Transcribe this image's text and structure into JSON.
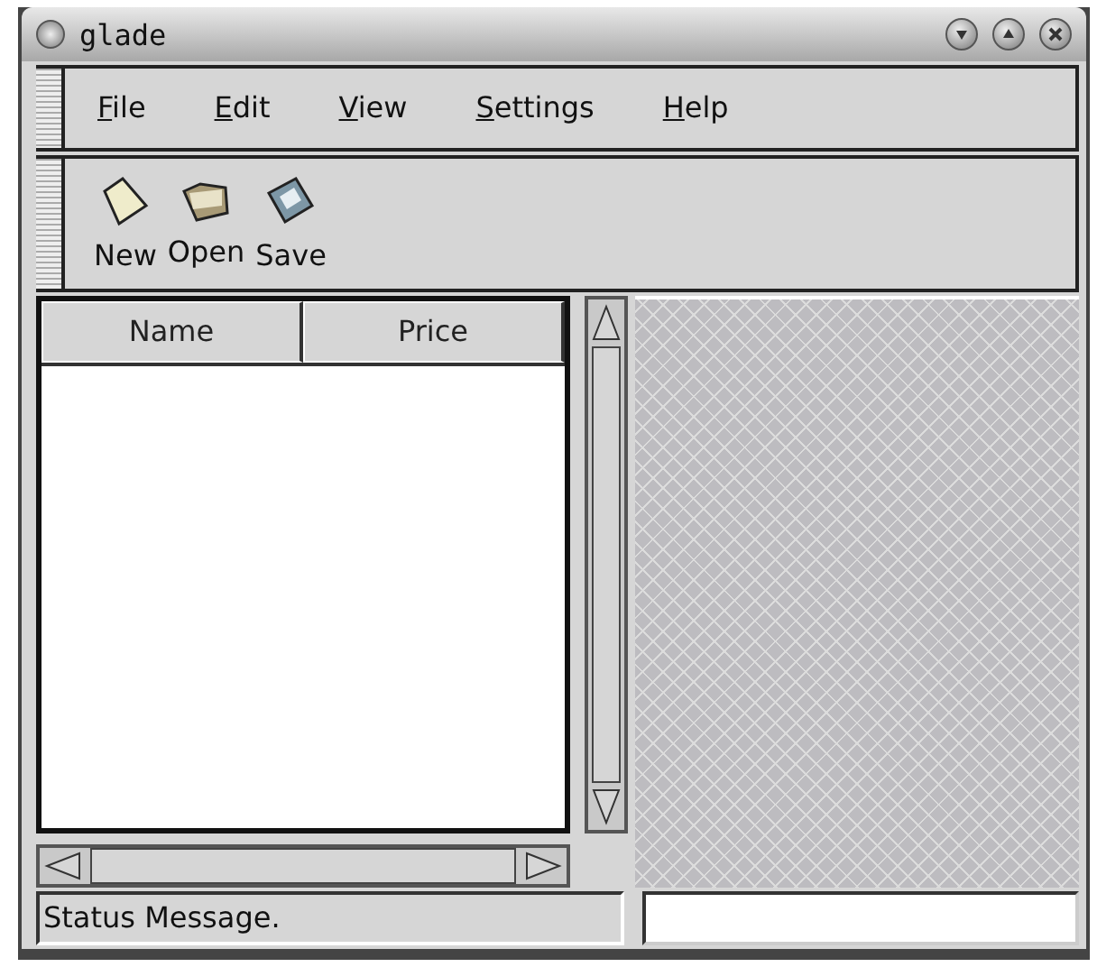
{
  "window": {
    "title": "glade"
  },
  "menu": [
    {
      "label": "File"
    },
    {
      "label": "Edit"
    },
    {
      "label": "View"
    },
    {
      "label": "Settings"
    },
    {
      "label": "Help"
    }
  ],
  "toolbar": [
    {
      "label": "New",
      "kind": "new"
    },
    {
      "label": "Open",
      "kind": "open"
    },
    {
      "label": "Save",
      "kind": "save"
    }
  ],
  "table": {
    "columns": [
      "Name",
      "Price"
    ]
  },
  "status_bar": {
    "message": "Status Message."
  }
}
